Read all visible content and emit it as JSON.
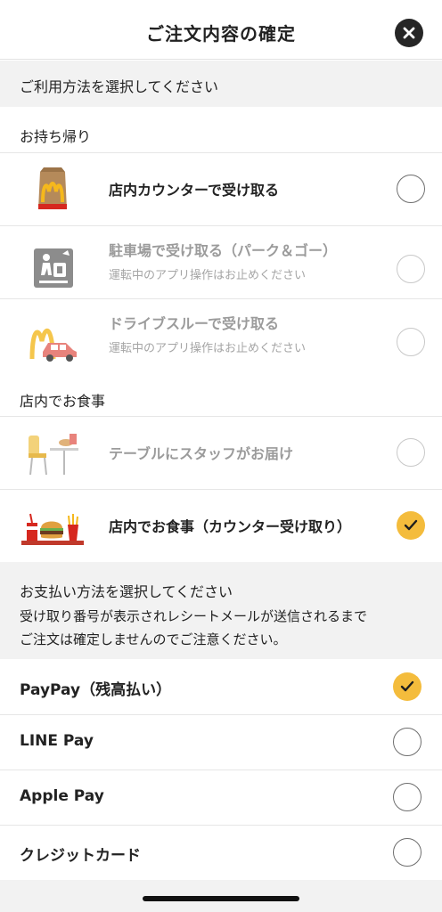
{
  "header": {
    "title": "ご注文内容の確定",
    "close_icon": "close-icon"
  },
  "usage": {
    "prompt": "ご利用方法を選択してください",
    "takeout": {
      "label": "お持ち帰り",
      "options": [
        {
          "label": "店内カウンターで受け取る",
          "sub": "",
          "selected": false,
          "disabled": false,
          "icon": "mcdonalds-bag-icon"
        },
        {
          "label": "駐車場で受け取る（パーク＆ゴー）",
          "sub": "運転中のアプリ操作はお止めください",
          "selected": false,
          "disabled": true,
          "icon": "park-and-go-icon"
        },
        {
          "label": "ドライブスルーで受け取る",
          "sub": "運転中のアプリ操作はお止めください",
          "selected": false,
          "disabled": true,
          "icon": "drive-thru-icon"
        }
      ]
    },
    "eat_in": {
      "label": "店内でお食事",
      "options": [
        {
          "label": "テーブルにスタッフがお届け",
          "sub": "",
          "selected": false,
          "disabled": true,
          "icon": "table-delivery-icon"
        },
        {
          "label": "店内でお食事（カウンター受け取り）",
          "sub": "",
          "selected": true,
          "disabled": false,
          "icon": "burger-meal-tray-icon"
        }
      ]
    }
  },
  "payment": {
    "prompt": "お支払い方法を選択してください",
    "notice_line1": "受け取り番号が表示されレシートメールが送信されるまで",
    "notice_line2": "ご注文は確定しませんのでご注意ください。",
    "options": [
      {
        "label": "PayPay（残高払い）",
        "selected": true
      },
      {
        "label": "LINE Pay",
        "selected": false
      },
      {
        "label": "Apple Pay",
        "selected": false
      },
      {
        "label": "クレジットカード",
        "selected": false
      }
    ]
  },
  "colors": {
    "accent": "#f4bc3c",
    "mcd_red": "#d6281f",
    "mcd_yellow": "#f5b81c",
    "band_gray": "#f2f2f2"
  }
}
